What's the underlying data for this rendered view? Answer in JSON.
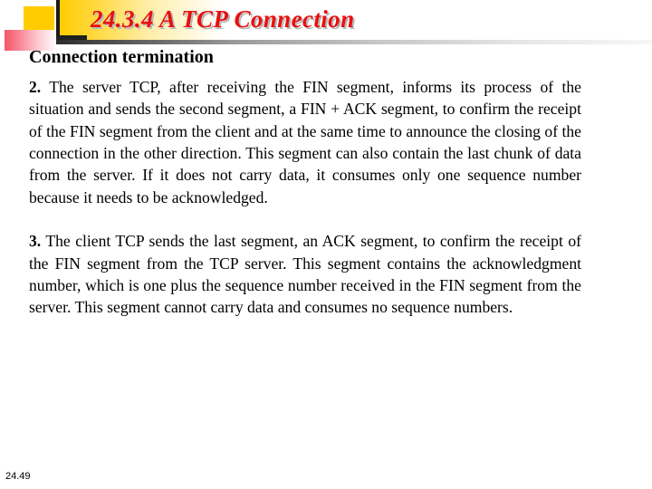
{
  "slide": {
    "title": "24.3.4  A TCP Connection",
    "subtitle": "Connection termination",
    "footer": "24.49",
    "paragraphs": [
      {
        "number": "2.",
        "text": " The server TCP, after receiving the FIN segment, informs its process of the situation and sends the second segment, a FIN + ACK segment, to confirm the receipt of the FIN segment from the client and at the same time to announce the closing of the connection in the other direction. This segment can also contain the last chunk of data from the server. If it does not carry data, it consumes only one sequence number because it needs to be acknowledged."
      },
      {
        "number": "3.",
        "text": " The client TCP sends the last segment, an ACK segment, to confirm the receipt of the FIN segment from the TCP server. This segment contains the acknowledgment number, which is one plus the sequence number received in the FIN segment from the server. This segment cannot carry data and consumes no sequence numbers."
      }
    ],
    "colors": {
      "title_red": "#e81010",
      "title_shadow": "#b9b9b9",
      "accent_yellow": "#ffcc00",
      "accent_red": "#f4566a",
      "bar_black": "#1a1a1a",
      "body_text": "#000000",
      "background": "#ffffff"
    }
  }
}
